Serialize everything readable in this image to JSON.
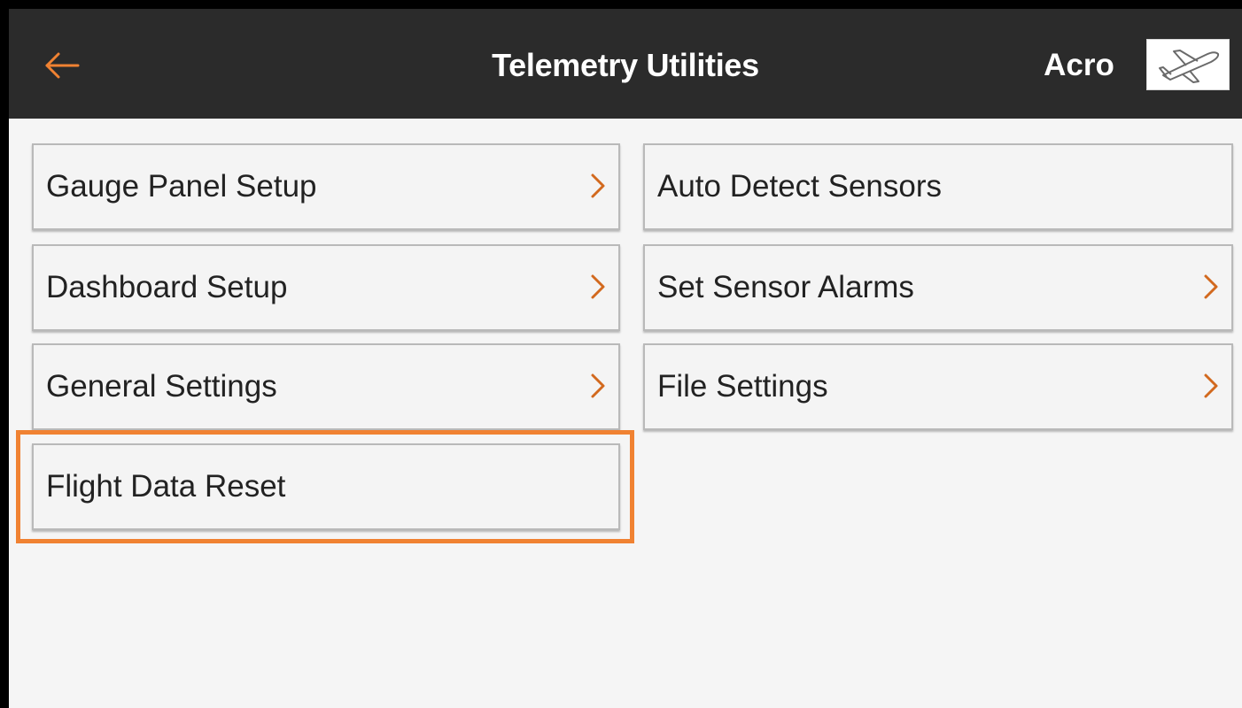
{
  "header": {
    "title": "Telemetry Utilities",
    "model_type": "Acro",
    "back_icon": "back-arrow-icon",
    "model_icon": "airplane-icon"
  },
  "menu": {
    "left": [
      {
        "label": "Gauge Panel Setup",
        "has_chevron": true
      },
      {
        "label": "Dashboard Setup",
        "has_chevron": true
      },
      {
        "label": "General Settings",
        "has_chevron": true
      },
      {
        "label": "Flight Data Reset",
        "has_chevron": false,
        "highlighted": true
      }
    ],
    "right": [
      {
        "label": "Auto Detect Sensors",
        "has_chevron": false
      },
      {
        "label": "Set Sensor Alarms",
        "has_chevron": true
      },
      {
        "label": "File Settings",
        "has_chevron": true
      }
    ]
  },
  "colors": {
    "accent": "#f08232",
    "header_bg": "#2b2b2b",
    "screen_bg": "#f5f5f5",
    "button_border": "#b9b9b9"
  }
}
